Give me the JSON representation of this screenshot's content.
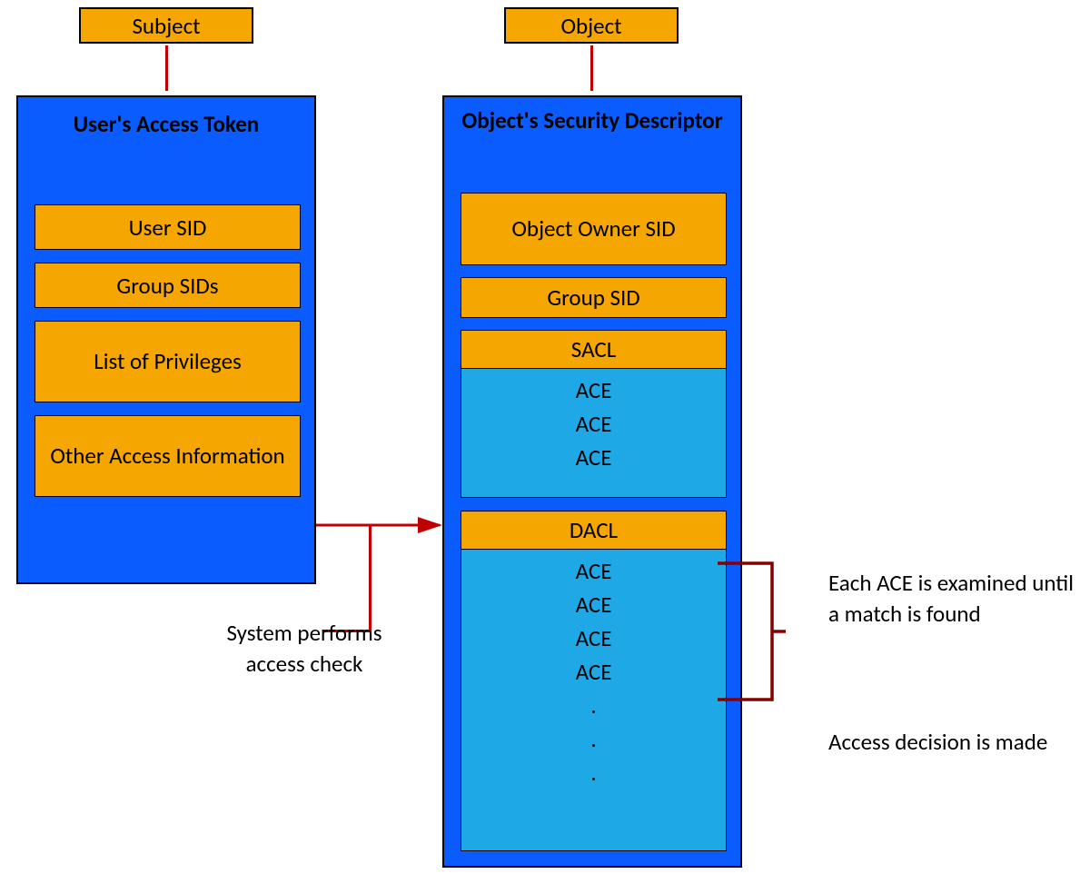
{
  "subject_label": "Subject",
  "object_label": "Object",
  "token": {
    "title": "User's Access Token",
    "user_sid": "User SID",
    "group_sids": "Group SIDs",
    "privileges": "List of Privileges",
    "other": "Other Access Information"
  },
  "descriptor": {
    "title": "Object's Security Descriptor",
    "owner_sid": "Object Owner SID",
    "group_sid": "Group SID",
    "sacl": {
      "header": "SACL",
      "entries": [
        "ACE",
        "ACE",
        "ACE"
      ]
    },
    "dacl": {
      "header": "DACL",
      "entries": [
        "ACE",
        "ACE",
        "ACE",
        "ACE",
        ".",
        ".",
        "."
      ]
    }
  },
  "annotations": {
    "system_check": "System performs access check",
    "each_ace": "Each ACE is examined until a match is found",
    "decision": "Access decision is made"
  }
}
